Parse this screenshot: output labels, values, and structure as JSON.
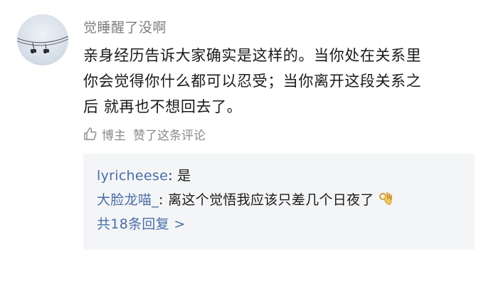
{
  "comment": {
    "username": "觉睡醒了没啊",
    "lines": [
      "亲身经历告诉大家确实是这样的。当你处在关系里",
      "你会觉得你什么都可以忍受；当你离开这段关系之",
      "后 就再也不想回去了。"
    ],
    "like_icon": "thumbs-up-icon",
    "author_tag": "博主",
    "liked_text": "赞了这条评论"
  },
  "replies": {
    "items": [
      {
        "name": "lyricheese",
        "separator": ": ",
        "text": "是"
      },
      {
        "name": "大脸龙喵_",
        "separator": ": ",
        "text": "离这个觉悟我应该只差几个日夜了",
        "emoji": "ok-hand-emoji"
      }
    ],
    "more_label": "共18条回复 >"
  },
  "colors": {
    "link": "#4a6fa5",
    "meta": "#8a8a8a",
    "reply_bg": "#f4f5f7"
  }
}
